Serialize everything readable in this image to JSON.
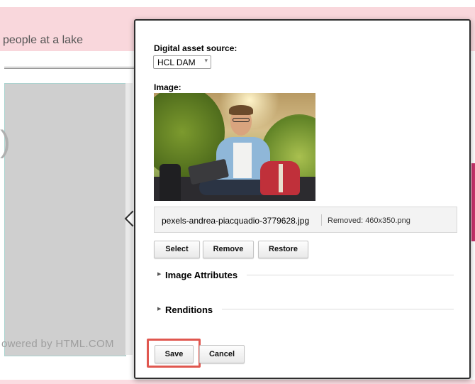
{
  "background": {
    "banner_text": "people at a lake",
    "preview_glyph": ")",
    "powered_text": "owered by HTML.COM"
  },
  "dialog": {
    "source_label": "Digital asset source:",
    "source_value": "HCL DAM",
    "image_label": "Image:",
    "file_name": "pexels-andrea-piacquadio-3779628.jpg",
    "removed_text": "Removed: 460x350.png",
    "buttons": {
      "select": "Select",
      "remove": "Remove",
      "restore": "Restore"
    },
    "sections": {
      "image_attributes": "Image Attributes",
      "renditions": "Renditions"
    },
    "footer": {
      "save": "Save",
      "cancel": "Cancel"
    }
  },
  "colors": {
    "banner_pink": "#f9d7dc",
    "save_highlight": "#e0574f",
    "accent_magenta": "#c8346b"
  },
  "icons": {
    "select_chevron": "chevron-down-icon",
    "section_toggle": "triangle-right-icon"
  }
}
